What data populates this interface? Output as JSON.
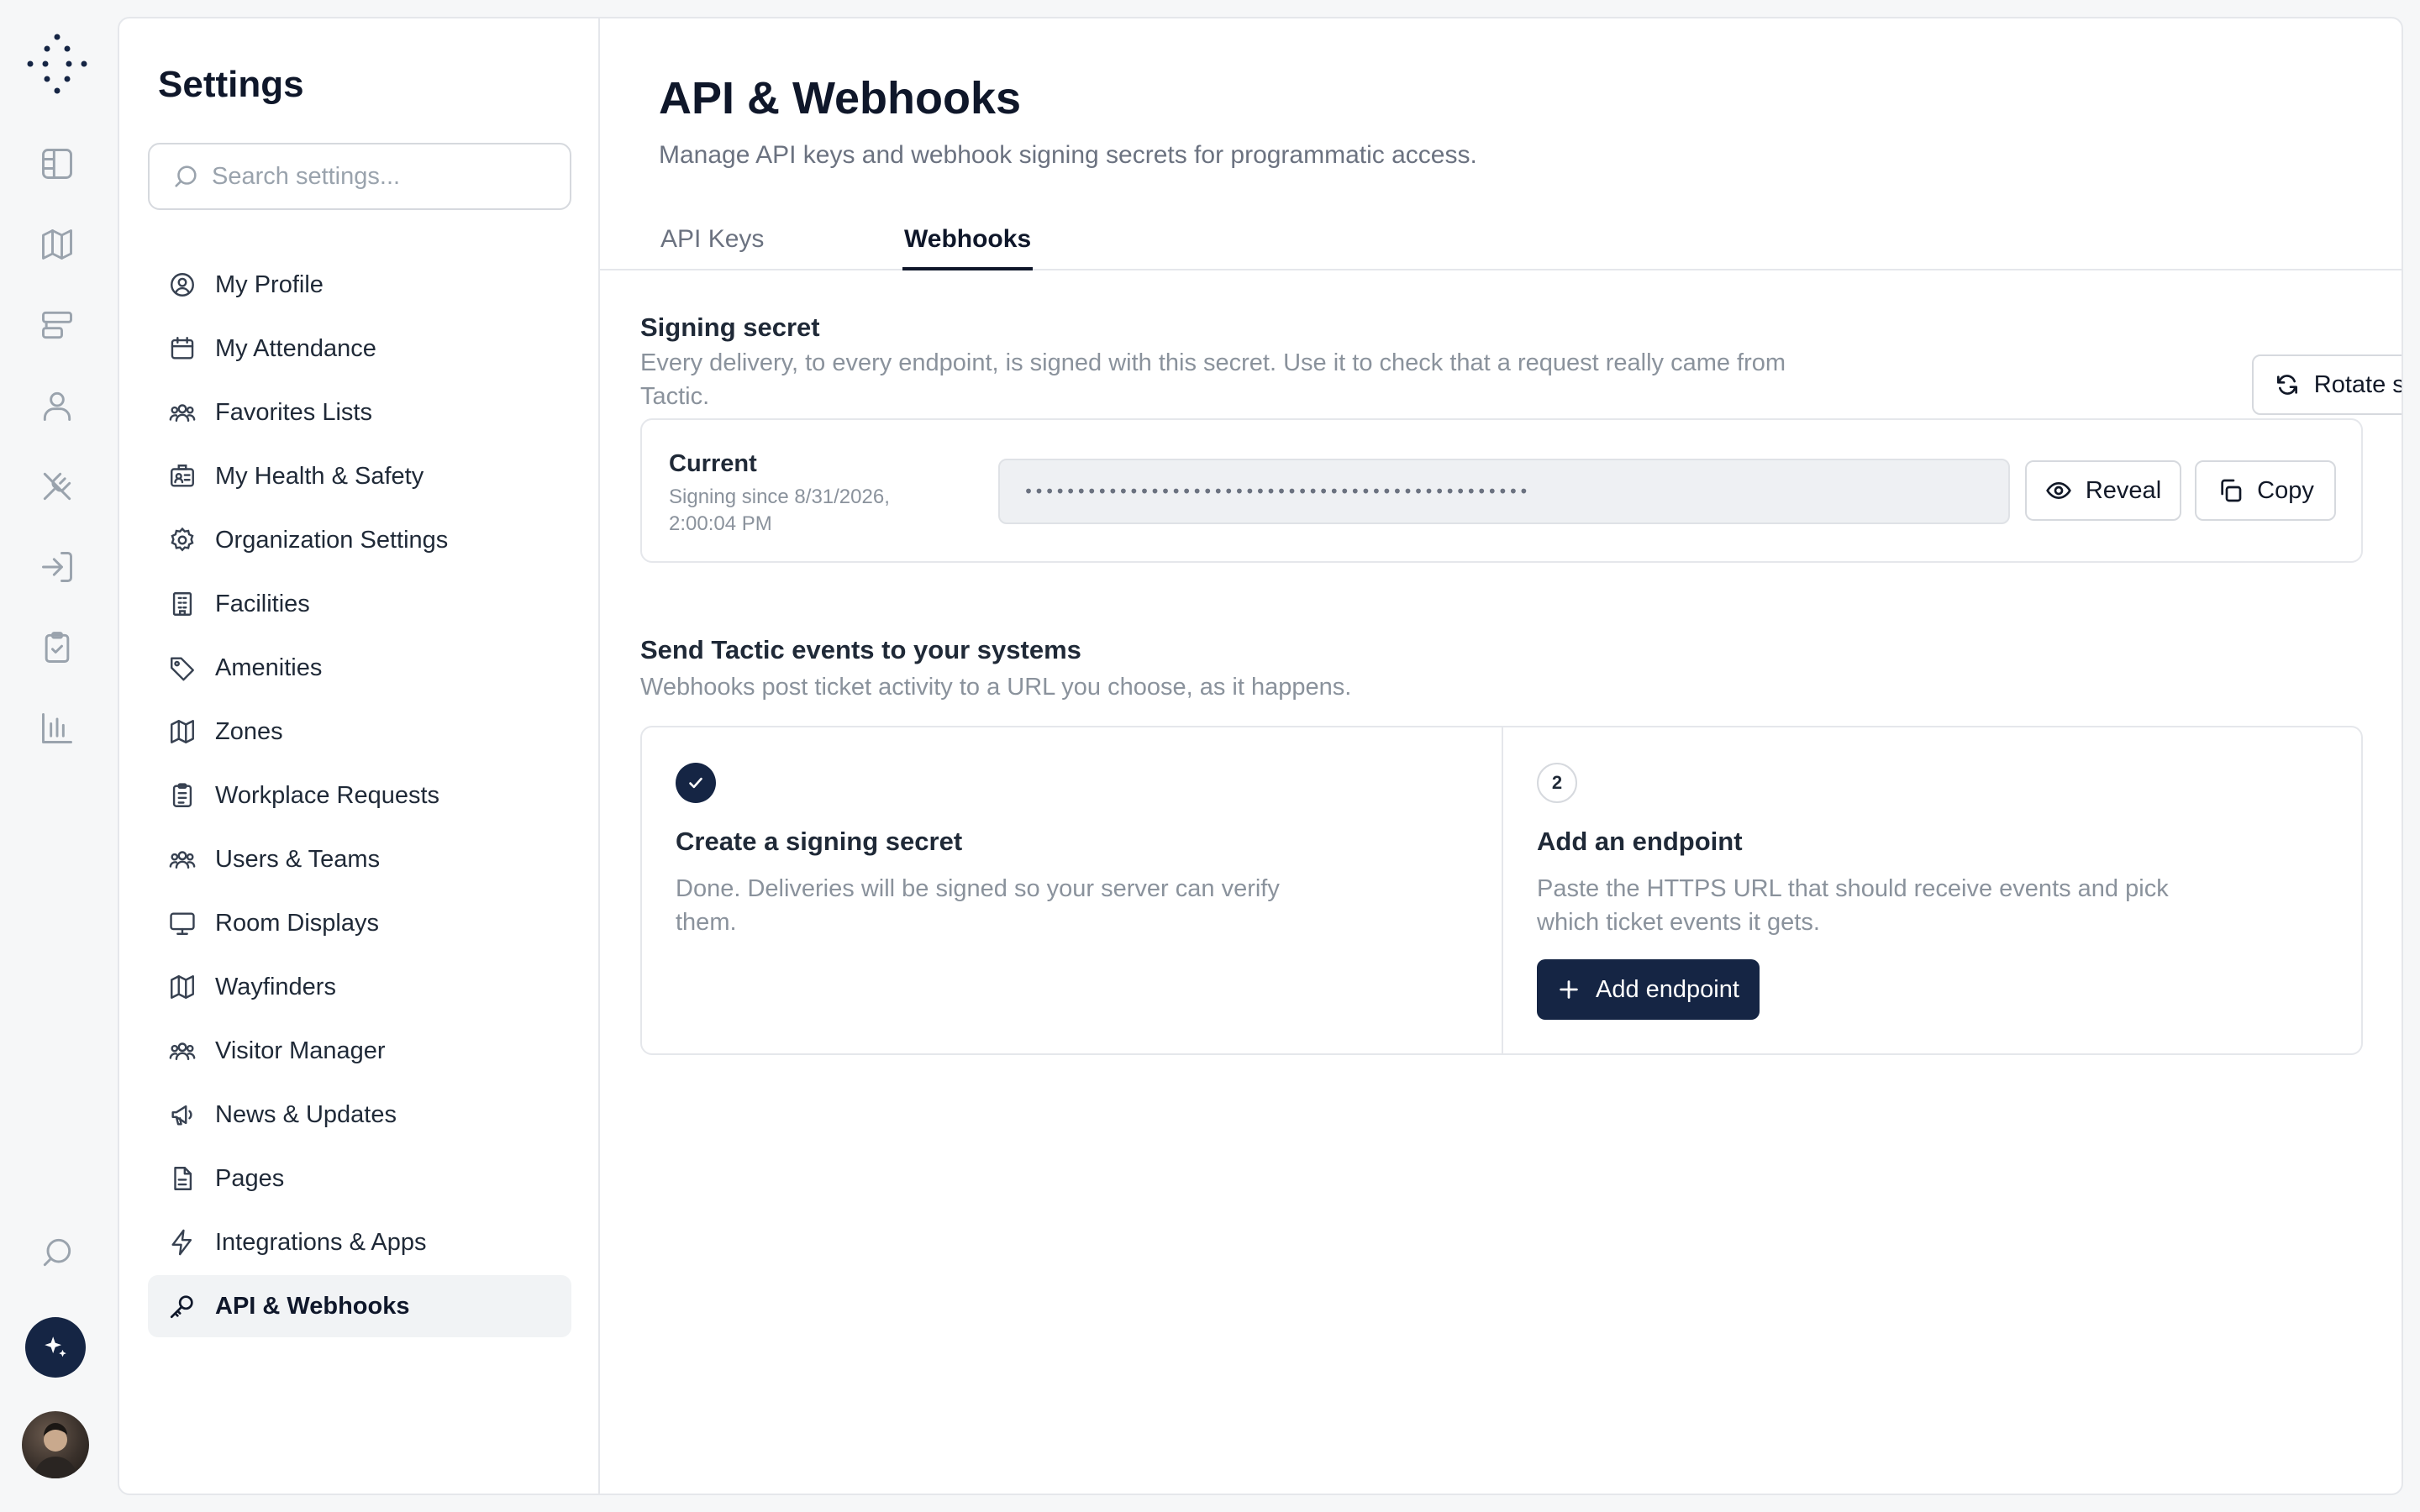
{
  "rail": {
    "logo_icon": "dot-grid-logo-icon",
    "items": [
      "layout-icon",
      "map-icon",
      "desks-icon",
      "user-icon",
      "utensils-icon",
      "sign-in-icon",
      "clipboard-check-icon",
      "bar-chart-icon",
      "search-icon"
    ],
    "assistant_icon": "sparkle-icon",
    "avatar_icon": "user-avatar"
  },
  "settings": {
    "title": "Settings",
    "search_placeholder": "Search settings...",
    "nav": [
      {
        "label": "My Profile",
        "icon": "user-circle-icon"
      },
      {
        "label": "My Attendance",
        "icon": "calendar-icon"
      },
      {
        "label": "Favorites Lists",
        "icon": "users-icon"
      },
      {
        "label": "My Health & Safety",
        "icon": "id-card-icon"
      },
      {
        "label": "Organization Settings",
        "icon": "gear-icon"
      },
      {
        "label": "Facilities",
        "icon": "building-icon"
      },
      {
        "label": "Amenities",
        "icon": "tag-icon"
      },
      {
        "label": "Zones",
        "icon": "map-icon"
      },
      {
        "label": "Workplace Requests",
        "icon": "clipboard-icon"
      },
      {
        "label": "Users & Teams",
        "icon": "users-icon"
      },
      {
        "label": "Room Displays",
        "icon": "monitor-icon"
      },
      {
        "label": "Wayfinders",
        "icon": "map-icon"
      },
      {
        "label": "Visitor Manager",
        "icon": "users-icon"
      },
      {
        "label": "News & Updates",
        "icon": "megaphone-icon"
      },
      {
        "label": "Pages",
        "icon": "file-icon"
      },
      {
        "label": "Integrations & Apps",
        "icon": "bolt-icon"
      },
      {
        "label": "API & Webhooks",
        "icon": "key-icon",
        "active": true
      }
    ]
  },
  "page": {
    "title": "API & Webhooks",
    "subtitle": "Manage API keys and webhook signing secrets for programmatic access.",
    "tabs": [
      {
        "label": "API Keys",
        "active": false
      },
      {
        "label": "Webhooks",
        "active": true
      }
    ]
  },
  "signing": {
    "title": "Signing secret",
    "description": "Every delivery, to every endpoint, is signed with this secret. Use it to check that a request really came from Tactic.",
    "rotate_label": "Rotate secret",
    "current_label": "Current",
    "since_text": "Signing since 8/31/2026, 2:00:04 PM",
    "masked_value": "••••••••••••••••••••••••••••••••••••••••••••••••",
    "reveal_label": "Reveal",
    "copy_label": "Copy"
  },
  "events": {
    "title": "Send Tactic events to your systems",
    "description": "Webhooks post ticket activity to a URL you choose, as it happens.",
    "steps": [
      {
        "status": "done",
        "title": "Create a signing secret",
        "description": "Done. Deliveries will be signed so your server can verify them."
      },
      {
        "number": "2",
        "title": "Add an endpoint",
        "description": "Paste the HTTPS URL that should receive events and pick which ticket events it gets.",
        "button_label": "Add endpoint"
      }
    ]
  }
}
